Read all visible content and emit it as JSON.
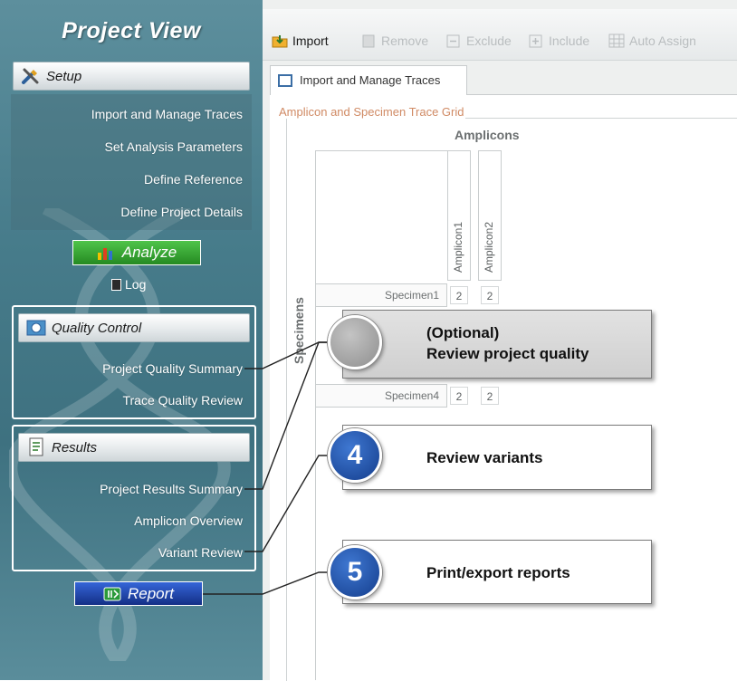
{
  "sidebar": {
    "title": "Project View",
    "setup": {
      "header": "Setup",
      "items": [
        "Import and Manage Traces",
        "Set Analysis Parameters",
        "Define Reference",
        "Define Project Details"
      ]
    },
    "analyze_label": "Analyze",
    "log_label": "Log",
    "quality_control": {
      "header": "Quality Control",
      "items": [
        "Project Quality Summary",
        "Trace Quality Review"
      ]
    },
    "results": {
      "header": "Results",
      "items": [
        "Project Results Summary",
        "Amplicon Overview",
        "Variant Review"
      ]
    },
    "report_label": "Report"
  },
  "toolbar": {
    "import": "Import",
    "remove": "Remove",
    "exclude": "Exclude",
    "include": "Include",
    "auto_assign": "Auto Assign"
  },
  "tab": {
    "label": "Import and Manage Traces"
  },
  "grid": {
    "legend": "Amplicon and Specimen Trace Grid",
    "amplicons_header": "Amplicons",
    "specimens_header": "Specimens",
    "amplicons": [
      "Amplicon1",
      "Amplicon2"
    ],
    "specimens": [
      {
        "name": "Specimen1",
        "values": [
          "2",
          "2"
        ]
      },
      {
        "name": "Specimen4",
        "values": [
          "2",
          "2"
        ]
      }
    ]
  },
  "callouts": {
    "optional": {
      "line1": "(Optional)",
      "line2": "Review project quality"
    },
    "step4": {
      "number": "4",
      "text": "Review variants"
    },
    "step5": {
      "number": "5",
      "text": "Print/export reports"
    }
  },
  "colors": {
    "sidebar": "#477c8b",
    "analyze_green": "#2e9a2a",
    "report_blue": "#1d3fa0",
    "badge_blue": "#1d4fa6",
    "legend_orange": "#d08a64"
  }
}
